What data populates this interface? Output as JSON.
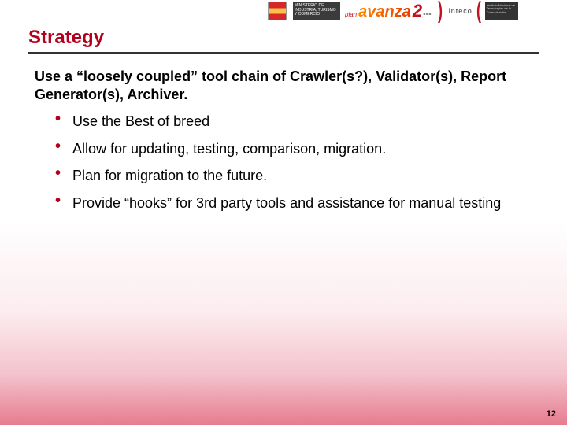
{
  "header": {
    "logo_gob_alt": "Gobierno de España",
    "logo_ministerio_text": "MINISTERIO DE INDUSTRIA, TURISMO Y COMERCIO",
    "avanza_plan": "plan",
    "avanza_word": "avanza",
    "avanza_num": "2",
    "avanza_dots": "▪▪▪",
    "inteco_word": "inteco",
    "inteco_caption": "Instituto Nacional de Tecnologías de la Comunicación"
  },
  "title": "Strategy",
  "intro": "Use a “loosely coupled” tool chain of  Crawler(s?), Validator(s), Report Generator(s), Archiver.",
  "bullets": [
    "Use the Best of breed",
    "Allow for updating, testing, comparison, migration.",
    "Plan for migration to the future.",
    "Provide “hooks” for 3rd party tools and assistance for manual testing"
  ],
  "page_number": "12"
}
